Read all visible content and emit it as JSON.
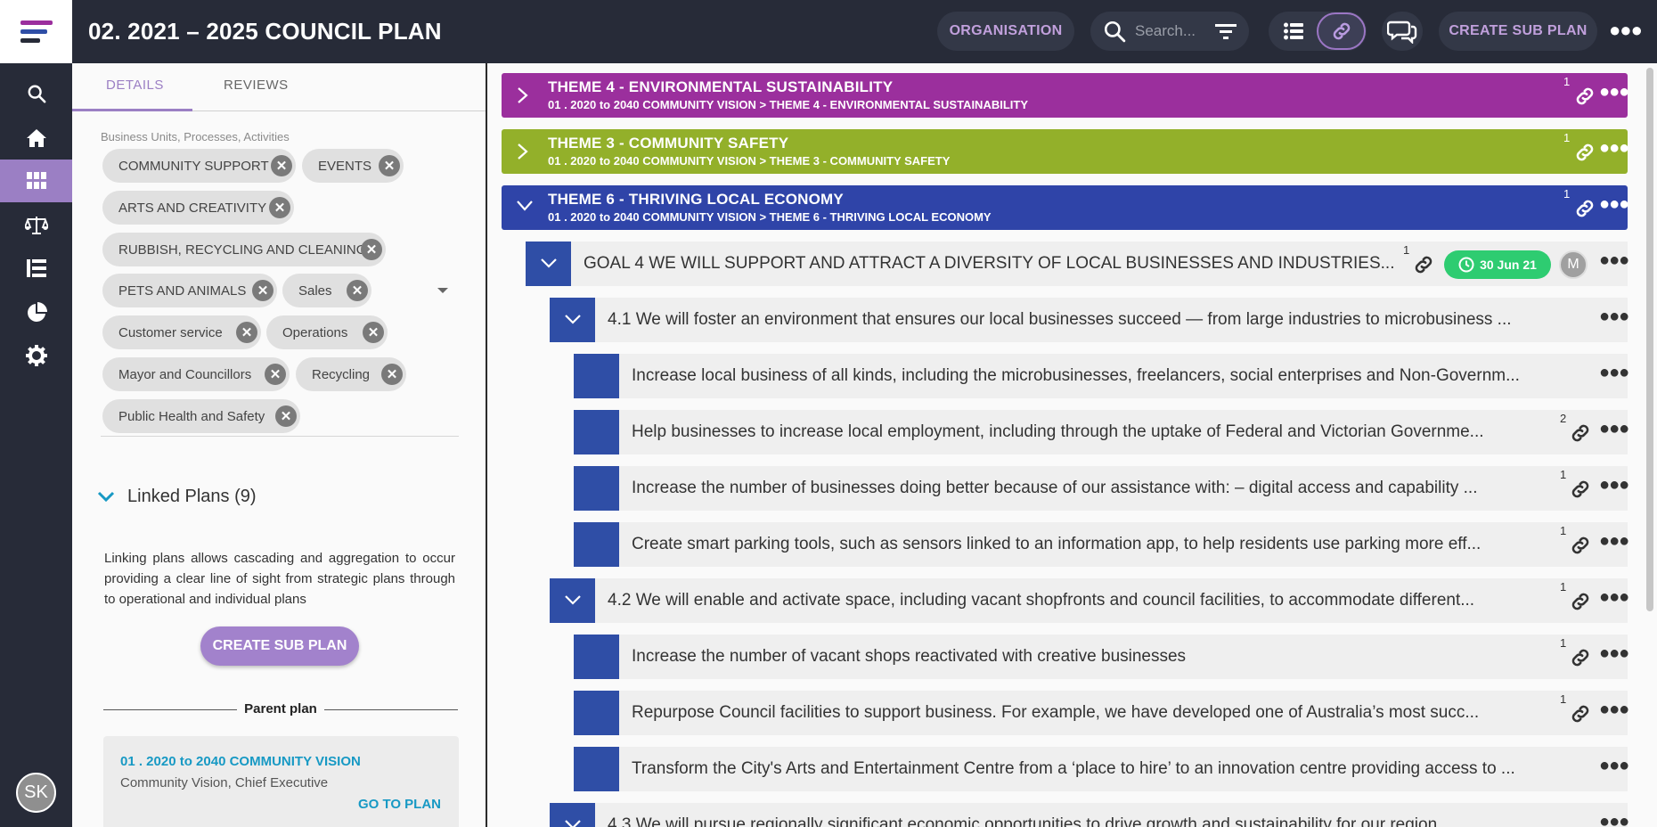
{
  "header": {
    "title": "02. 2021 – 2025 COUNCIL PLAN",
    "organisation_label": "ORGANISATION",
    "search_placeholder": "Search...",
    "create_sub_plan_label": "CREATE SUB PLAN"
  },
  "user": {
    "initials": "SK"
  },
  "tabs": [
    {
      "label": "DETAILS",
      "active": true
    },
    {
      "label": "REVIEWS",
      "active": false
    }
  ],
  "details": {
    "chips_label": "Business Units, Processes, Activities",
    "chips": [
      "COMMUNITY SUPPORT",
      "EVENTS",
      "ARTS AND CREATIVITY",
      "RUBBISH, RECYCLING AND CLEANING",
      "PETS AND ANIMALS",
      "Sales",
      "Customer service",
      "Operations",
      "Mayor and Councillors",
      "Recycling",
      "Public Health and Safety"
    ],
    "linked_plans_title": "Linked Plans (9)",
    "linked_desc": "Linking plans allows cascading and aggregation to occur providing a clear line of sight from strategic plans through to operational and individual plans",
    "create_sub_plan_label": "CREATE SUB PLAN",
    "parent_plan_label": "Parent plan",
    "parent": {
      "name": "01 . 2020 to 2040 COMMUNITY VISION",
      "meta": "Community Vision, Chief Executive",
      "goto_label": "GO TO PLAN"
    }
  },
  "themes": [
    {
      "title": "THEME 4 - ENVIRONMENTAL SUSTAINABILITY",
      "path": "01 . 2020 to 2040 COMMUNITY VISION > THEME 4 - ENVIRONMENTAL SUSTAINABILITY",
      "count": "1",
      "color": "#9b2f9d",
      "expanded": false
    },
    {
      "title": "THEME 3 - COMMUNITY SAFETY",
      "path": "01 . 2020 to 2040 COMMUNITY VISION > THEME 3 - COMMUNITY SAFETY",
      "count": "1",
      "color": "#93b02a",
      "expanded": false
    },
    {
      "title": "THEME 6 - THRIVING LOCAL ECONOMY",
      "path": "01 . 2020 to 2040 COMMUNITY VISION > THEME 6 - THRIVING LOCAL ECONOMY",
      "count": "1",
      "color": "#2f44a8",
      "expanded": true
    }
  ],
  "goal": {
    "text": "GOAL 4 WE WILL SUPPORT AND ATTRACT A DIVERSITY OF LOCAL BUSINESSES AND INDUSTRIES...",
    "count": "1",
    "date": "30 Jun 21",
    "avatar": "M"
  },
  "items": [
    {
      "text": "4.1 We will foster an environment that ensures our local businesses succeed — from large industries to microbusiness ...",
      "count": ""
    },
    {
      "text": "Increase local business of all kinds, including the microbusinesses, freelancers, social enterprises and Non-Governm...",
      "count": ""
    },
    {
      "text": "Help businesses to increase local employment, including through the uptake of Federal and Victorian Governme...",
      "count": "2"
    },
    {
      "text": "Increase the number of businesses doing better because of our assistance with: – digital access and capability ...",
      "count": "1"
    },
    {
      "text": "Create smart parking tools, such as sensors linked to an information app, to help residents use parking more eff...",
      "count": "1"
    },
    {
      "text": "4.2 We will enable and activate space, including vacant shopfronts and council facilities, to accommodate different...",
      "count": "1"
    },
    {
      "text": "Increase the number of vacant shops reactivated with creative businesses",
      "count": "1"
    },
    {
      "text": "Repurpose Council facilities to support business. For example, we have developed one of Australia’s most succ...",
      "count": "1"
    },
    {
      "text": "Transform the City's Arts and Entertainment Centre from a ‘place to hire’ to an innovation centre providing access to ...",
      "count": ""
    },
    {
      "text": "4.3 We will pursue regionally significant economic opportunities to drive growth and sustainability for our region",
      "count": ""
    }
  ],
  "colors": {
    "accent": "#9b7fc4",
    "link": "#1799c4",
    "navy": "#272b38",
    "item_box": "#2f4ea6",
    "badge_green": "#2ecc71"
  }
}
